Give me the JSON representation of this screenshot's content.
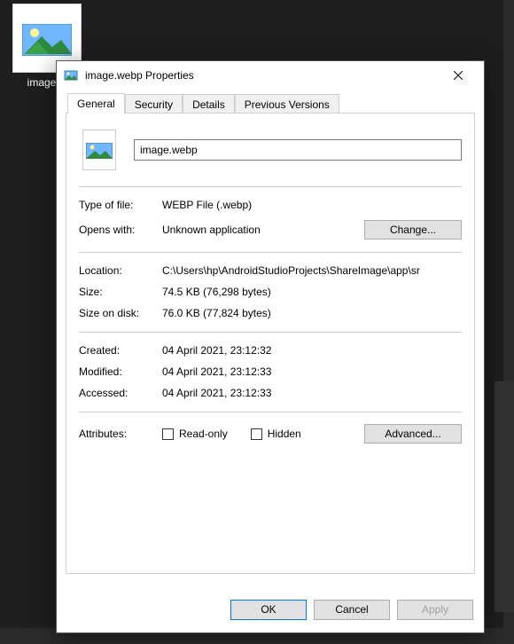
{
  "desktop": {
    "file_name": "image.w",
    "full_name": "image.webp"
  },
  "dialog": {
    "title": "image.webp Properties",
    "tabs": {
      "general": "General",
      "security": "Security",
      "details": "Details",
      "previous": "Previous Versions"
    },
    "filename": "image.webp",
    "fields": {
      "type_label": "Type of file:",
      "type_value": "WEBP File (.webp)",
      "opens_label": "Opens with:",
      "opens_value": "Unknown application",
      "change_btn": "Change...",
      "location_label": "Location:",
      "location_value": "C:\\Users\\hp\\AndroidStudioProjects\\ShareImage\\app\\sr",
      "size_label": "Size:",
      "size_value": "74.5 KB (76,298 bytes)",
      "disk_label": "Size on disk:",
      "disk_value": "76.0 KB (77,824 bytes)",
      "created_label": "Created:",
      "created_value": "04 April 2021, 23:12:32",
      "modified_label": "Modified:",
      "modified_value": "04 April 2021, 23:12:33",
      "accessed_label": "Accessed:",
      "accessed_value": "04 April 2021, 23:12:33",
      "attr_label": "Attributes:",
      "readonly_label": "Read-only",
      "hidden_label": "Hidden",
      "advanced_btn": "Advanced..."
    },
    "buttons": {
      "ok": "OK",
      "cancel": "Cancel",
      "apply": "Apply"
    }
  }
}
